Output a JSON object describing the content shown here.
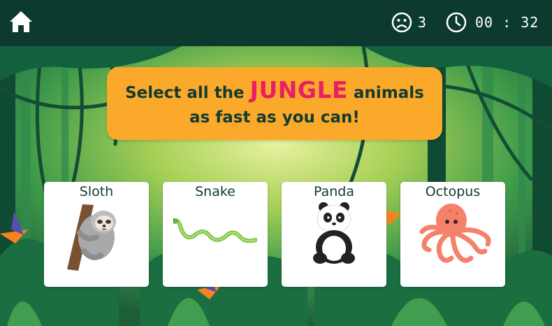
{
  "header": {
    "home_icon": "home-icon",
    "mistakes_icon": "sad-face-icon",
    "mistakes_count": "3",
    "timer_icon": "clock-icon",
    "timer_text": "00 : 32"
  },
  "banner": {
    "prefix": "Select all the ",
    "highlight": "JUNGLE",
    "suffix": " animals",
    "line2": "as fast as you can!"
  },
  "animals": [
    {
      "label": "Sloth",
      "icon": "sloth-icon"
    },
    {
      "label": "Snake",
      "icon": "snake-icon"
    },
    {
      "label": "Panda",
      "icon": "panda-icon"
    },
    {
      "label": "Octopus",
      "icon": "octopus-icon"
    }
  ],
  "colors": {
    "topbar": "#0c3a2f",
    "banner": "#fba92a",
    "highlight": "#e91e63",
    "text_dark": "#123b30"
  }
}
